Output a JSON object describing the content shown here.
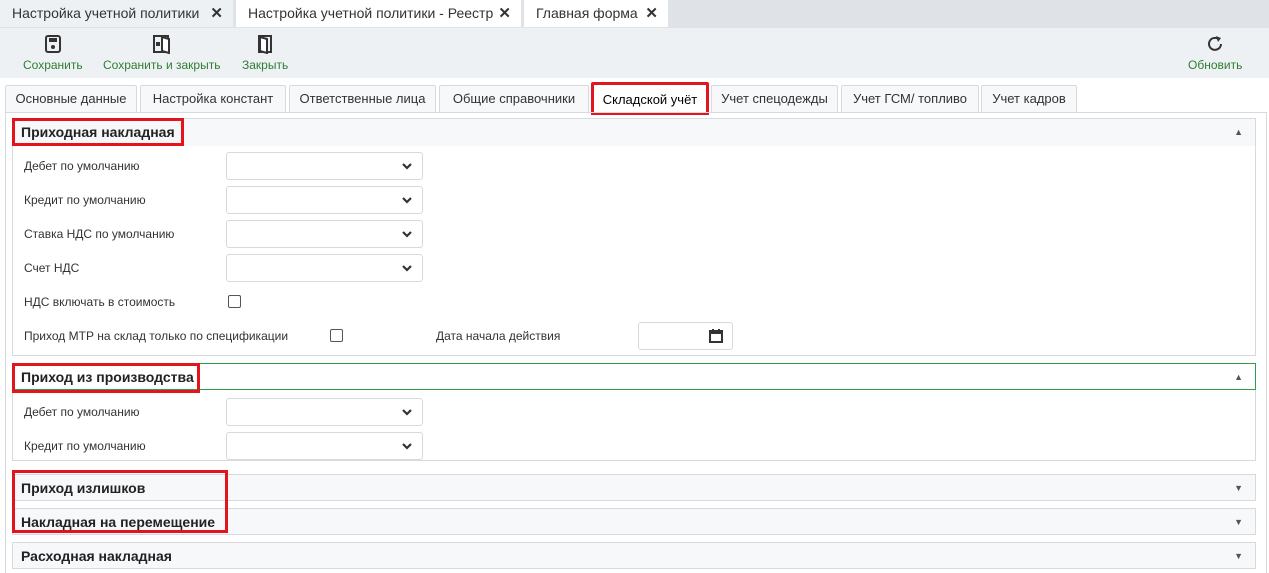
{
  "window_tabs": [
    {
      "label": "Настройка учетной политики"
    },
    {
      "label": "Настройка учетной политики - Реестр"
    },
    {
      "label": "Главная форма"
    }
  ],
  "toolbar": {
    "save": "Сохранить",
    "save_close": "Сохранить и закрыть",
    "close": "Закрыть",
    "refresh": "Обновить"
  },
  "tabs": [
    "Основные данные",
    "Настройка констант",
    "Ответственные лица",
    "Общие справочники",
    "Складской учёт",
    "Учет спецодежды",
    "Учет ГСМ/ топливо",
    "Учет кадров"
  ],
  "sections": {
    "incoming": {
      "title": "Приходная накладная",
      "debit": "Дебет по умолчанию",
      "credit": "Кредит по умолчанию",
      "vat_rate": "Ставка НДС по умолчанию",
      "vat_account": "Счет НДС",
      "vat_include": "НДС включать в стоимость",
      "mtr_spec": "Приход МТР на склад только по спецификации",
      "start_date": "Дата начала действия"
    },
    "production": {
      "title": "Приход из производства",
      "debit": "Дебет по умолчанию",
      "credit": "Кредит по умолчанию"
    },
    "surplus": {
      "title": "Приход излишков"
    },
    "transfer": {
      "title": "Накладная на перемещение"
    },
    "outgoing": {
      "title": "Расходная накладная"
    }
  },
  "accent_color": "#2e7d32",
  "highlight_color": "#e3141c"
}
